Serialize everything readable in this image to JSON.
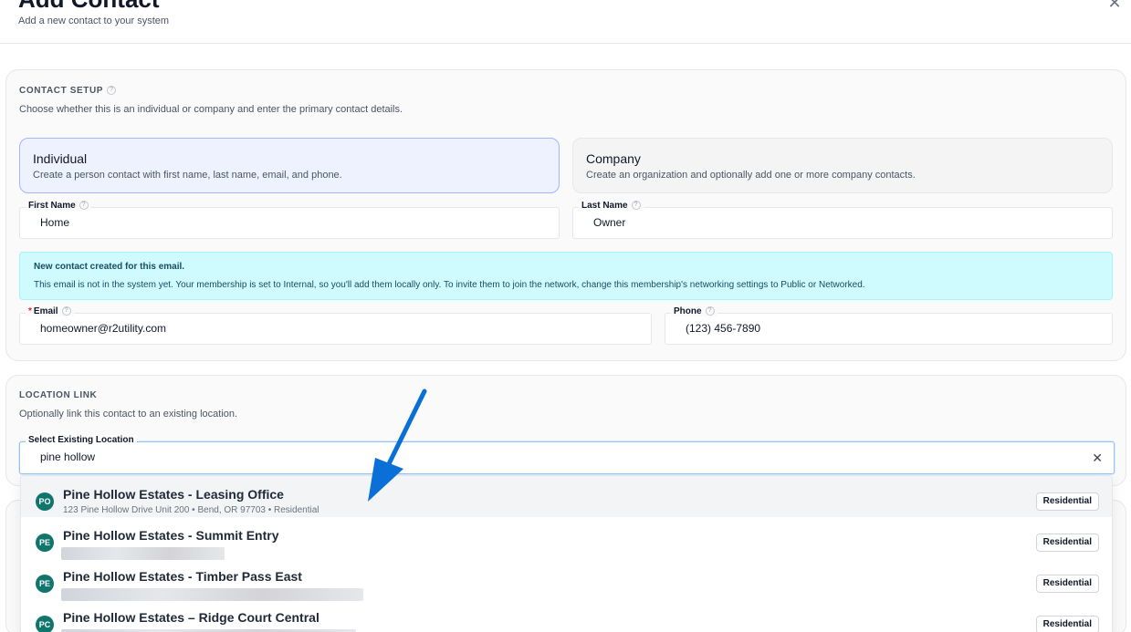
{
  "header": {
    "title": "Add Contact",
    "subtitle": "Add a new contact to your system"
  },
  "contact_setup": {
    "section_title": "CONTACT SETUP",
    "description": "Choose whether this is an individual or company and enter the primary contact details.",
    "types": [
      {
        "title": "Individual",
        "description": "Create a person contact with first name, last name, email, and phone.",
        "selected": true
      },
      {
        "title": "Company",
        "description": "Create an organization and optionally add one or more company contacts.",
        "selected": false
      }
    ],
    "fields": {
      "first_name": {
        "label": "First Name",
        "value": "Home"
      },
      "last_name": {
        "label": "Last Name",
        "value": "Owner"
      },
      "email": {
        "label": "Email",
        "required_mark": "*",
        "value": "homeowner@r2utility.com"
      },
      "phone": {
        "label": "Phone",
        "value": "(123) 456-7890"
      }
    },
    "notice": {
      "title": "New contact created for this email.",
      "body": "This email is not in the system yet. Your membership is set to Internal, so you'll add them locally only. To invite them to join the network, change this membership's networking settings to Public or Networked."
    }
  },
  "location_link": {
    "section_title": "LOCATION LINK",
    "description": "Optionally link this contact to an existing location.",
    "select_label": "Select Existing Location",
    "search_value": "pine hollow",
    "options": [
      {
        "initials": "PO",
        "name": "Pine Hollow Estates - Leasing Office",
        "address": "123 Pine Hollow Drive Unit 200 • Bend, OR 97703 • Residential",
        "badge": "Residential"
      },
      {
        "initials": "PE",
        "name": "Pine Hollow Estates - Summit Entry",
        "address": "",
        "badge": "Residential"
      },
      {
        "initials": "PE",
        "name": "Pine Hollow Estates - Timber Pass East",
        "address": "",
        "badge": "Residential"
      },
      {
        "initials": "PC",
        "name": "Pine Hollow Estates – Ridge Court Central",
        "address": "",
        "badge": "Residential"
      }
    ]
  },
  "icons": {
    "close": "close-icon",
    "help": "help-icon",
    "clear": "clear-icon",
    "annotation_arrow": "arrow-icon"
  },
  "colors": {
    "accent": "#6366f1",
    "notice_bg": "#cffafe",
    "avatar": "#0f766e",
    "arrow": "#0a6fd6"
  }
}
